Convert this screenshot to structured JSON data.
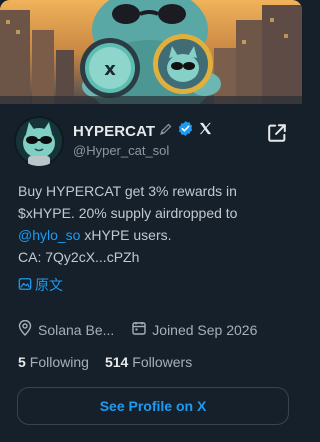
{
  "profile": {
    "display_name": "HYPERCAT",
    "handle": "@Hyper_cat_sol",
    "icons": [
      "pencil-icon",
      "verified-badge-icon",
      "x-logo-icon",
      "open-external-icon"
    ],
    "accent_color": "#1d9bf0"
  },
  "bio": {
    "line1": "Buy HYPERCAT get 3% rewards in",
    "line2": "$xHYPE. 20% supply airdropped to",
    "mention": "@hylo_so",
    "line3_rest": " xHYPE users.",
    "line4": "CA: 7Qy2cX...cPZh"
  },
  "translate": {
    "label": "原文",
    "icon": "translate-icon"
  },
  "meta": {
    "location": "Solana Be...",
    "location_icon": "location-pin-icon",
    "joined": "Joined Sep 2026",
    "joined_icon": "calendar-icon"
  },
  "stats": {
    "following_count": "5",
    "following_label": "Following",
    "followers_count": "514",
    "followers_label": "Followers"
  },
  "actions": {
    "see_profile": "See Profile on X"
  }
}
